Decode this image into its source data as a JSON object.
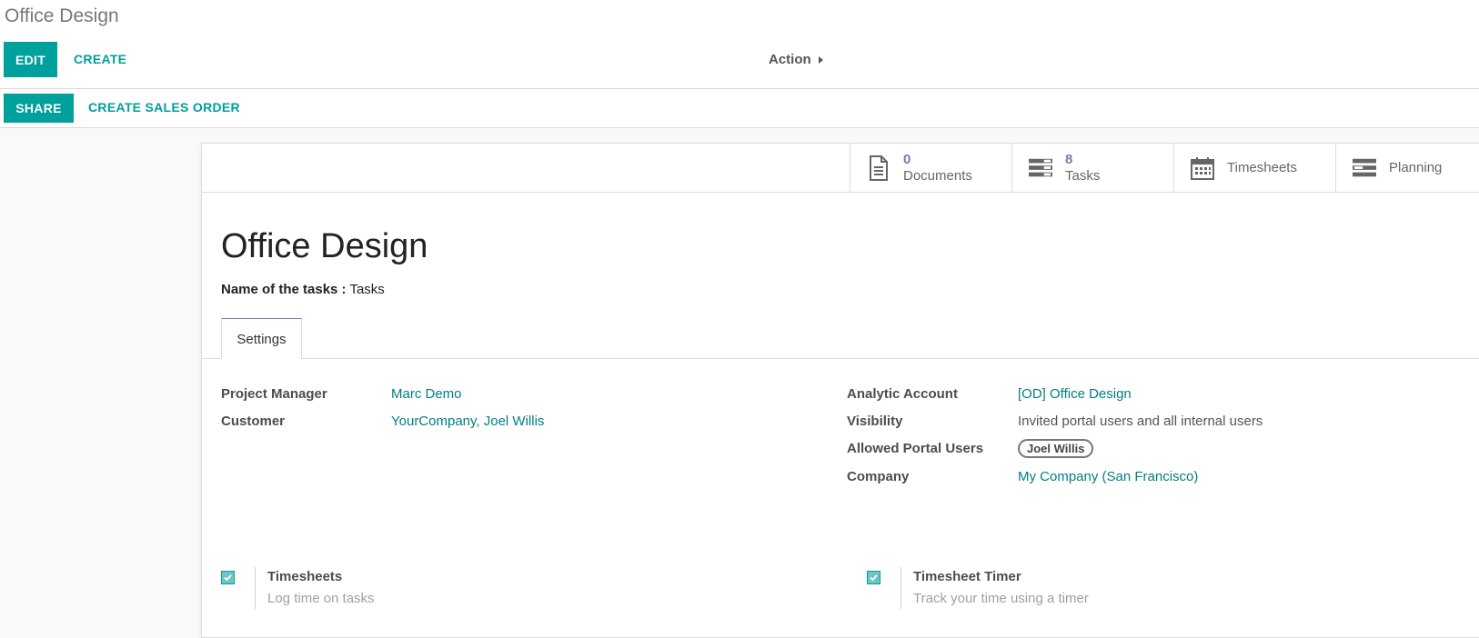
{
  "breadcrumb": {
    "title": "Office Design"
  },
  "control_panel": {
    "edit_label": "EDIT",
    "create_label": "CREATE",
    "action_label": "Action"
  },
  "header_buttons": {
    "share_label": "SHARE",
    "create_sales_order_label": "CREATE SALES ORDER"
  },
  "smart_buttons": {
    "documents": {
      "value": "0",
      "label": "Documents",
      "icon": "document-icon"
    },
    "tasks": {
      "value": "8",
      "label": "Tasks",
      "icon": "tasks-icon"
    },
    "timesheets": {
      "label": "Timesheets",
      "icon": "calendar-icon"
    },
    "planning": {
      "label": "Planning",
      "icon": "planning-icon"
    }
  },
  "record": {
    "title": "Office Design",
    "tasks_name_label": "Name of the tasks :",
    "tasks_name_value": "Tasks"
  },
  "tabs": [
    {
      "label": "Settings",
      "active": true
    }
  ],
  "fields_left": {
    "project_manager": {
      "label": "Project Manager",
      "value": "Marc Demo"
    },
    "customer": {
      "label": "Customer",
      "value": "YourCompany, Joel Willis"
    }
  },
  "fields_right": {
    "analytic_account": {
      "label": "Analytic Account",
      "value": "[OD] Office Design"
    },
    "visibility": {
      "label": "Visibility",
      "value": "Invited portal users and all internal users"
    },
    "allowed_portal_users": {
      "label": "Allowed Portal Users",
      "tags": [
        "Joel Willis"
      ]
    },
    "company": {
      "label": "Company",
      "value": "My Company (San Francisco)"
    }
  },
  "options": {
    "timesheets": {
      "title": "Timesheets",
      "help": "Log time on tasks",
      "checked": true
    },
    "timesheet_timer": {
      "title": "Timesheet Timer",
      "help": "Track your time using a timer",
      "checked": true
    }
  },
  "colors": {
    "primary": "#00a09d",
    "link": "#017e84",
    "stat_value": "#7c7bad"
  }
}
